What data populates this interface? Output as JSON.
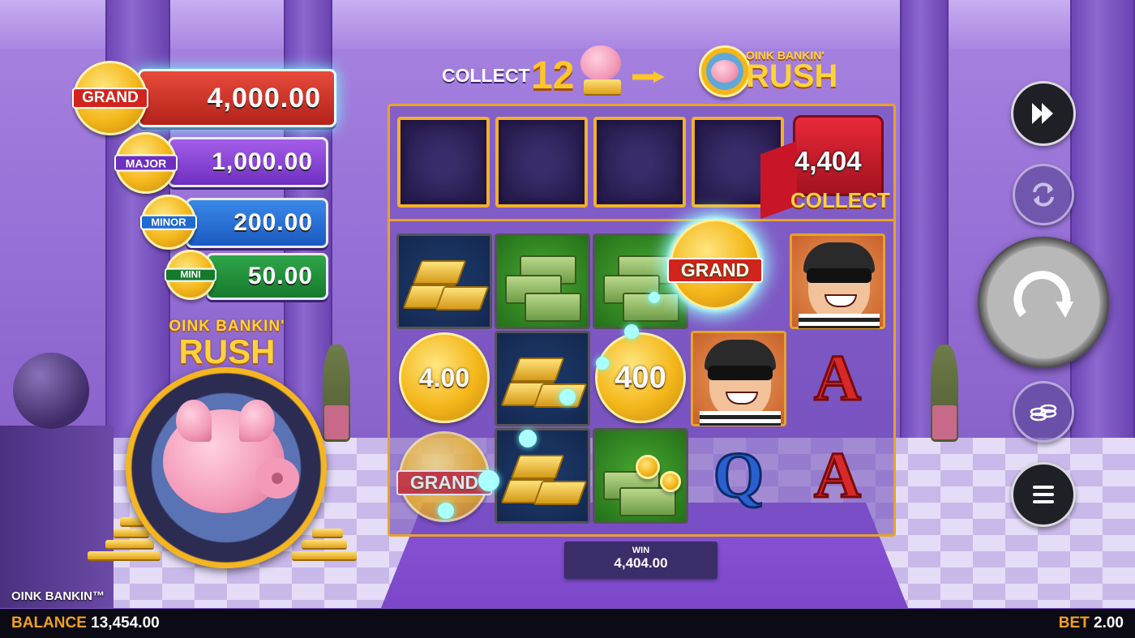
{
  "game": {
    "title": "OINK BANKIN™"
  },
  "jackpots": {
    "grand": {
      "tag": "GRAND",
      "value": "4,000.00"
    },
    "major": {
      "tag": "MAJOR",
      "value": "1,000.00"
    },
    "minor": {
      "tag": "MINOR",
      "value": "200.00"
    },
    "mini": {
      "tag": "MINI",
      "value": "50.00"
    }
  },
  "rush_logo": {
    "line1": "OINK BANKIN'",
    "line2": "RUSH"
  },
  "collect_banner": {
    "label": "COLLECT",
    "count": "12"
  },
  "collect_row": {
    "amount": "4,404",
    "label": "COLLECT"
  },
  "grid": {
    "coin_values": {
      "r2c1": "4.00",
      "r2c3": "400",
      "r1c4": "GRAND",
      "r3c1": "GRAND"
    },
    "letters": {
      "r2c5": "A",
      "r3c4": "Q",
      "r3c5": "A"
    }
  },
  "win": {
    "label": "WIN",
    "value": "4,404.00"
  },
  "footer": {
    "balance_label": "BALANCE",
    "balance": "13,454.00",
    "bet_label": "BET",
    "bet": "2.00"
  },
  "controls": [
    "fast-forward-icon",
    "autoplay-icon",
    "spin-icon",
    "coins-icon",
    "menu-icon"
  ],
  "colors": {
    "grand": "#d0241c",
    "major": "#6d2fc0",
    "minor": "#1d6ad0",
    "mini": "#147a2c",
    "accent": "#f0a020"
  }
}
